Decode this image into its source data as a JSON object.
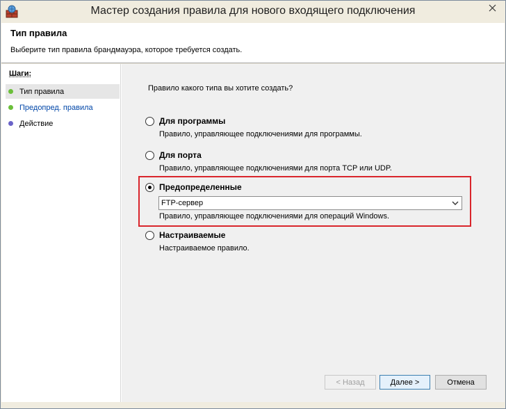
{
  "window": {
    "title": "Мастер создания правила для нового входящего подключения",
    "icon": "firewall-icon"
  },
  "header": {
    "title": "Тип правила",
    "description": "Выберите тип правила брандмауэра, которое требуется создать."
  },
  "steps": {
    "heading": "Шаги:",
    "items": [
      {
        "label": "Тип правила",
        "status_color": "#6bbf3a"
      },
      {
        "label": "Предопред. правила",
        "status_color": "#6bbf3a"
      },
      {
        "label": "Действие",
        "status_color": "#6a63c8"
      }
    ]
  },
  "content": {
    "question": "Правило какого типа вы хотите создать?",
    "options": [
      {
        "label": "Для программы",
        "description": "Правило, управляющее подключениями для программы.",
        "selected": false
      },
      {
        "label": "Для порта",
        "description": "Правило, управляющее подключениями для порта TCP или UDP.",
        "selected": false
      },
      {
        "label": "Предопределенные",
        "description": "Правило, управляющее подключениями для операций Windows.",
        "selected": true
      },
      {
        "label": "Настраиваемые",
        "description": "Настраиваемое правило.",
        "selected": false
      }
    ],
    "predefined_select": {
      "value": "FTP-сервер"
    },
    "highlight_color": "#d9252b"
  },
  "buttons": {
    "back": "< Назад",
    "next": "Далее >",
    "cancel": "Отмена"
  }
}
